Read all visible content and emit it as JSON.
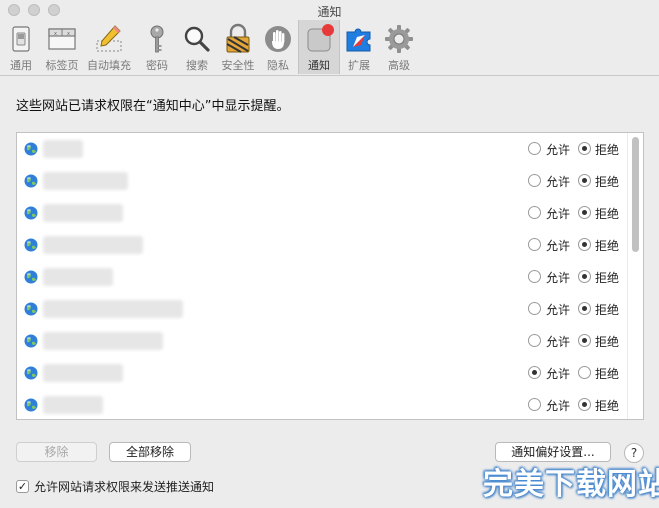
{
  "window": {
    "title": "通知"
  },
  "toolbar": {
    "items": [
      {
        "label": "通用",
        "icon": "general-switch-icon"
      },
      {
        "label": "标签页",
        "icon": "tabs-icon"
      },
      {
        "label": "自动填充",
        "icon": "autofill-pencil-icon"
      },
      {
        "label": "密码",
        "icon": "key-icon"
      },
      {
        "label": "搜索",
        "icon": "magnifier-icon"
      },
      {
        "label": "安全性",
        "icon": "padlock-icon"
      },
      {
        "label": "隐私",
        "icon": "hand-icon"
      },
      {
        "label": "通知",
        "icon": "notification-icon",
        "active": true
      },
      {
        "label": "扩展",
        "icon": "puzzle-icon"
      },
      {
        "label": "高级",
        "icon": "gear-icon"
      }
    ]
  },
  "description": "这些网站已请求权限在“通知中心”中显示提醒。",
  "sites": {
    "allow_label": "允许",
    "deny_label": "拒绝",
    "rows": [
      {
        "setting": "deny"
      },
      {
        "setting": "deny"
      },
      {
        "setting": "deny"
      },
      {
        "setting": "deny"
      },
      {
        "setting": "deny"
      },
      {
        "setting": "deny"
      },
      {
        "setting": "deny"
      },
      {
        "setting": "allow"
      },
      {
        "setting": "deny"
      }
    ]
  },
  "buttons": {
    "remove": "移除",
    "remove_all": "全部移除",
    "preferences": "通知偏好设置...",
    "help": "?"
  },
  "checkbox": {
    "label": "允许网站请求权限来发送推送通知",
    "checked": true,
    "mark": "✓"
  },
  "watermark": "完美下载网站",
  "colors": {
    "accent_red": "#e8393a",
    "safari_blue": "#1f7ee0"
  }
}
